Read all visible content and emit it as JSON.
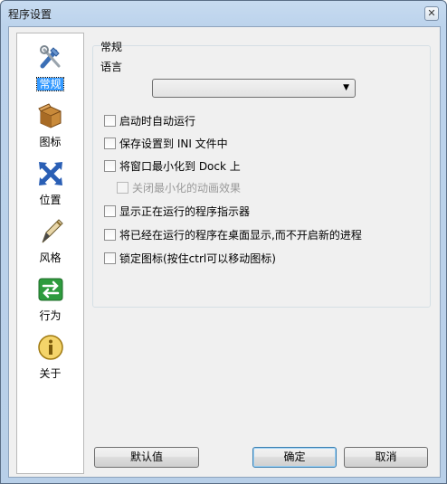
{
  "window": {
    "title": "程序设置",
    "close_glyph": "✕"
  },
  "sidebar": {
    "items": [
      {
        "label": "常规",
        "icon": "tools-icon",
        "active": true
      },
      {
        "label": "图标",
        "icon": "box-icon",
        "active": false
      },
      {
        "label": "位置",
        "icon": "arrows-icon",
        "active": false
      },
      {
        "label": "风格",
        "icon": "pen-icon",
        "active": false
      },
      {
        "label": "行为",
        "icon": "switch-icon",
        "active": false
      },
      {
        "label": "关于",
        "icon": "info-icon",
        "active": false
      }
    ]
  },
  "general": {
    "section_title": "常规",
    "language_label": "语言",
    "language_value": "",
    "options": [
      {
        "label": "启动时自动运行",
        "checked": false,
        "enabled": true
      },
      {
        "label": "保存设置到 INI 文件中",
        "checked": false,
        "enabled": true
      },
      {
        "label": "将窗口最小化到 Dock 上",
        "checked": false,
        "enabled": true
      },
      {
        "label": "关闭最小化的动画效果",
        "checked": false,
        "enabled": false
      },
      {
        "label": "显示正在运行的程序指示器",
        "checked": false,
        "enabled": true
      },
      {
        "label": "将已经在运行的程序在桌面显示,而不开启新的进程",
        "checked": false,
        "enabled": true
      },
      {
        "label": "锁定图标(按住ctrl可以移动图标)",
        "checked": false,
        "enabled": true
      }
    ]
  },
  "footer": {
    "default_label": "默认值",
    "ok_label": "确定",
    "cancel_label": "取消"
  },
  "colors": {
    "selection": "#3399ff",
    "title_bar": "#c7dbf0",
    "dialog_bg": "#f0f0f0"
  }
}
